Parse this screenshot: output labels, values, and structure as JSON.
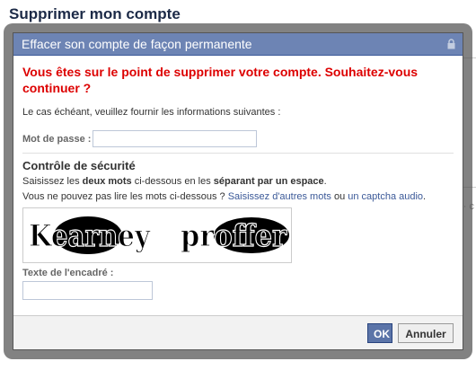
{
  "page": {
    "title": "Supprimer mon compte",
    "background_fragment": "· c"
  },
  "dialog": {
    "title": "Effacer son compte de façon permanente",
    "warning": "Vous êtes sur le point de supprimer votre compte. Souhaitez-vous continuer ?",
    "intro": "Le cas échéant, veuillez fournir les informations suivantes :",
    "password": {
      "label": "Mot de passe :",
      "value": ""
    },
    "security": {
      "title": "Contrôle de sécurité",
      "line1": {
        "a": "Saisissez les ",
        "b": "deux mots",
        "c": " ci-dessous en les ",
        "d": "séparant par un espace",
        "e": "."
      },
      "line2": {
        "a": "Vous ne pouvez pas lire les mots ci-dessous ? ",
        "link1": "Saisissez d'autres mots",
        "b": " ou ",
        "link2": "un captcha audio",
        "c": "."
      },
      "captcha_words": [
        "Kearney",
        "proffer"
      ]
    },
    "answer": {
      "label": "Texte de l'encadré :",
      "value": ""
    },
    "buttons": {
      "ok": "OK",
      "cancel": "Annuler"
    }
  },
  "colors": {
    "header": "#6d84b4",
    "warning": "#dd0000",
    "link": "#3b5998",
    "ok_button": "#5b74a8"
  }
}
